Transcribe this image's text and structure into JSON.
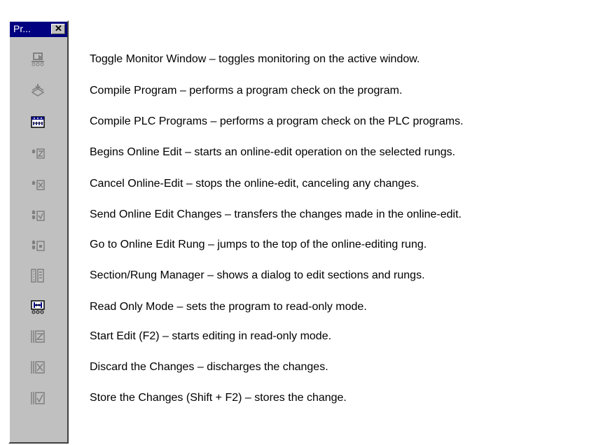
{
  "palette": {
    "title": "Pr...",
    "close_label": "x",
    "colors": {
      "titlebar": "#000080",
      "panel": "#c0c0c0",
      "icon_gray": "#808080",
      "icon_blue": "#000080"
    }
  },
  "tools": [
    {
      "icon": "toggle-monitor-icon",
      "enabled": false,
      "desc": "Toggle Monitor Window – toggles monitoring on the active window."
    },
    {
      "icon": "compile-program-icon",
      "enabled": false,
      "desc": "Compile Program – performs a program check on the program."
    },
    {
      "icon": "compile-plc-programs-icon",
      "enabled": true,
      "desc": "Compile PLC Programs – performs a program check on the PLC programs."
    },
    {
      "icon": "begin-online-edit-icon",
      "enabled": false,
      "desc": "Begins Online Edit – starts an online-edit operation on the selected rungs."
    },
    {
      "icon": "cancel-online-edit-icon",
      "enabled": false,
      "desc": "Cancel Online-Edit – stops the online-edit, canceling any changes."
    },
    {
      "icon": "send-online-edit-icon",
      "enabled": false,
      "desc": "Send Online Edit Changes – transfers the changes made in the online-edit."
    },
    {
      "icon": "goto-online-edit-rung-icon",
      "enabled": false,
      "desc": "Go to Online Edit Rung – jumps to the top of the online-editing rung."
    },
    {
      "icon": "section-rung-manager-icon",
      "enabled": false,
      "desc": "Section/Rung Manager – shows a dialog to edit sections and rungs."
    },
    {
      "icon": "read-only-mode-icon",
      "enabled": true,
      "desc": "Read Only Mode – sets the program to read-only mode."
    },
    {
      "icon": "start-edit-icon",
      "enabled": false,
      "desc": "Start Edit (F2) – starts editing in read-only mode."
    },
    {
      "icon": "discard-changes-icon",
      "enabled": false,
      "desc": "Discard the Changes – discharges the changes."
    },
    {
      "icon": "store-changes-icon",
      "enabled": false,
      "desc": "Store the Changes (Shift + F2) – stores the change."
    }
  ]
}
